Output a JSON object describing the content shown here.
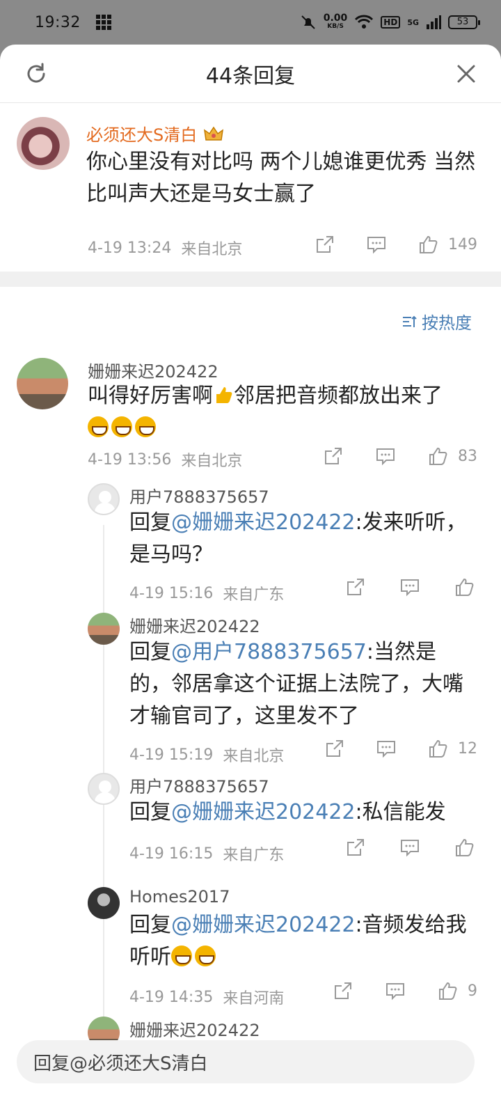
{
  "status_bar": {
    "time": "19:32",
    "net_speed": "0.00",
    "net_unit": "KB/S",
    "hd": "HD",
    "signal": "5G",
    "battery": "53"
  },
  "sheet": {
    "title": "44条回复",
    "sort_label": "按热度",
    "reply_placeholder": "回复@必须还大S清白"
  },
  "original_comment": {
    "user": "必须还大S清白",
    "text": "你心里没有对比吗 两个儿媳谁更优秀 当然 比叫声大还是马女士赢了",
    "time": "4-19 13:24",
    "location": "来自北京",
    "likes": "149"
  },
  "top_reply": {
    "user": "姗姗来迟202422",
    "text_before": "叫得好厉害啊",
    "text_after": "邻居把音频都放出来了",
    "time": "4-19 13:56",
    "location": "来自北京",
    "likes": "83"
  },
  "sub_replies": [
    {
      "user": "用户7888375657",
      "prefix": "回复",
      "mention": "@姗姗来迟202422",
      "text": ":发来听听，是马吗？",
      "time": "4-19 15:16",
      "location": "来自广东",
      "likes": ""
    },
    {
      "user": "姗姗来迟202422",
      "prefix": "回复",
      "mention": "@用户7888375657",
      "text": ":当然是的，邻居拿这个证据上法院了，大嘴才输官司了，这里发不了",
      "time": "4-19 15:19",
      "location": "来自北京",
      "likes": "12"
    },
    {
      "user": "用户7888375657",
      "prefix": "回复",
      "mention": "@姗姗来迟202422",
      "text": ":私信能发",
      "time": "4-19 16:15",
      "location": "来自广东",
      "likes": ""
    },
    {
      "user": "Homes2017",
      "prefix": "回复",
      "mention": "@姗姗来迟202422",
      "text": ":音频发给我听听",
      "time": "4-19 14:35",
      "location": "来自河南",
      "likes": "9"
    },
    {
      "user": "姗姗来迟202422"
    }
  ],
  "colors": {
    "accent_link": "#4a7fb5",
    "vip_name": "#e36a1f",
    "meta_grey": "#999999"
  }
}
